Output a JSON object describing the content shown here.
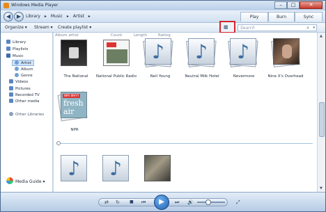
{
  "window": {
    "title": "Windows Media Player",
    "controls": {
      "minimize": "–",
      "maximize": "□",
      "close": "✕"
    }
  },
  "nav": {
    "back": "◀",
    "forward": "▶",
    "breadcrumb": [
      "Library",
      "▸",
      "Music",
      "▸",
      "Artist",
      "▸"
    ],
    "tabs": {
      "play": "Play",
      "burn": "Burn",
      "sync": "Sync"
    }
  },
  "toolbar": {
    "organize": "Organize ▾",
    "stream": "Stream ▾",
    "create_playlist": "Create playlist ▾",
    "view_icon": "▦",
    "search_placeholder": "Search",
    "search_icon": "search-icon"
  },
  "columns": {
    "album_artist": "Album artist",
    "count": "Count",
    "length": "Length",
    "rating": "Rating"
  },
  "sidebar": {
    "items": [
      {
        "label": "Library",
        "color": "#5a86c4"
      },
      {
        "label": "Playlists",
        "color": "#5a86c4"
      },
      {
        "label": "Music",
        "color": "#3a6db0"
      },
      {
        "label": "Artist",
        "color": "#6f9fd6"
      },
      {
        "label": "Album",
        "color": "#6f9fd6"
      },
      {
        "label": "Genre",
        "color": "#6f9fd6"
      },
      {
        "label": "Videos",
        "color": "#5a86c4"
      },
      {
        "label": "Pictures",
        "color": "#5a86c4"
      },
      {
        "label": "Recorded TV",
        "color": "#5a86c4"
      },
      {
        "label": "Other media",
        "color": "#5a86c4"
      },
      {
        "label": "Other Libraries",
        "color": "#8aa0ba"
      }
    ],
    "media_guide": "Media Guide ▾"
  },
  "artists": [
    {
      "name": "The National",
      "art": "photo-dark"
    },
    {
      "name": "National Public Radio",
      "art": "npr-planet"
    },
    {
      "name": "Neil Young",
      "art": "note"
    },
    {
      "name": "Neutral Milk Hotel",
      "art": "note"
    },
    {
      "name": "Nevermore",
      "art": "note"
    },
    {
      "name": "Nine X's Overhead",
      "art": "photo-face"
    },
    {
      "name": "NPR",
      "art": "npr-fresh"
    }
  ],
  "npr": {
    "badge": "NPR WHYY",
    "fresh": "fresh",
    "air": "air"
  },
  "player": {
    "shuffle": "⇄",
    "repeat": "↻",
    "stop": "■",
    "prev": "⏮",
    "play": "▶",
    "next": "⏭",
    "mute": "🔊",
    "switch": "⤢"
  }
}
